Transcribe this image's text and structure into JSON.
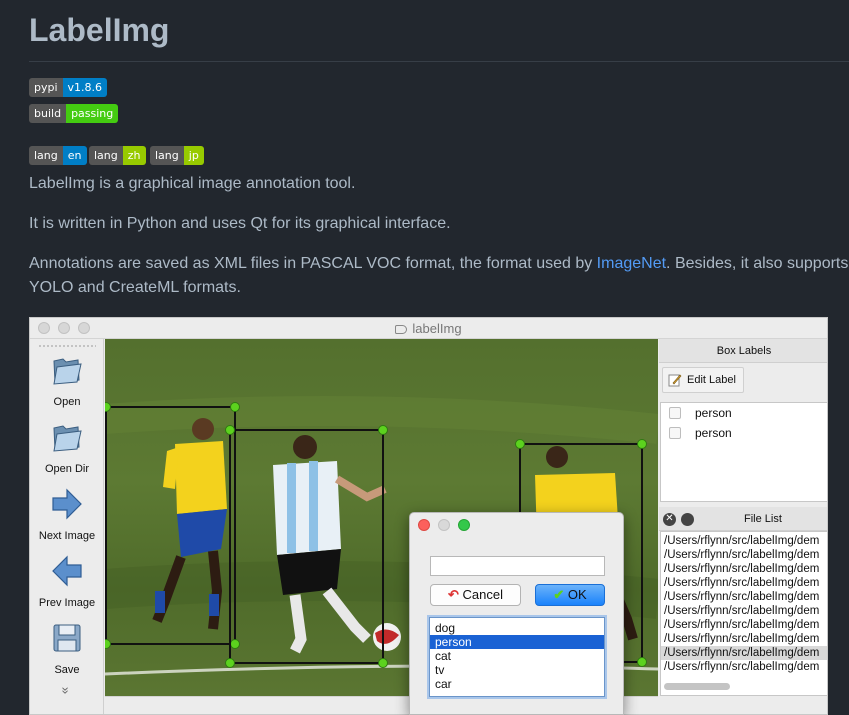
{
  "readme": {
    "title": "LabelImg",
    "badges": {
      "pypi": {
        "key": "pypi",
        "value": "v1.8.6",
        "color": "#007ec6"
      },
      "build": {
        "key": "build",
        "value": "passing",
        "color": "#4c1"
      },
      "lang_en": {
        "key": "lang",
        "value": "en",
        "color": "#007ec6"
      },
      "lang_zh": {
        "key": "lang",
        "value": "zh",
        "color": "#97ca00"
      },
      "lang_jp": {
        "key": "lang",
        "value": "jp",
        "color": "#97ca00"
      }
    },
    "paragraph1": "LabelImg is a graphical image annotation tool.",
    "paragraph2": "It is written in Python and uses Qt for its graphical interface.",
    "paragraph3_a": "Annotations are saved as XML files in PASCAL VOC format, the format used by ",
    "paragraph3_link": "ImageNet",
    "paragraph3_b": ". Besides, it also supports",
    "paragraph3_c": "YOLO and CreateML formats."
  },
  "app": {
    "window_title": "labelImg",
    "toolbar": [
      {
        "label": "Open",
        "icon": "folder-open-icon"
      },
      {
        "label": "Open Dir",
        "icon": "folder-open-icon"
      },
      {
        "label": "Next Image",
        "icon": "arrow-right-icon"
      },
      {
        "label": "Prev Image",
        "icon": "arrow-left-icon"
      },
      {
        "label": "Save",
        "icon": "save-icon"
      }
    ],
    "more_glyph": "»",
    "box_labels_title": "Box Labels",
    "edit_label_button": "Edit Label",
    "box_labels": [
      "person",
      "person"
    ],
    "file_list_title": "File List",
    "files": [
      "/Users/rflynn/src/labelImg/dem",
      "/Users/rflynn/src/labelImg/dem",
      "/Users/rflynn/src/labelImg/dem",
      "/Users/rflynn/src/labelImg/dem",
      "/Users/rflynn/src/labelImg/dem",
      "/Users/rflynn/src/labelImg/dem",
      "/Users/rflynn/src/labelImg/dem",
      "/Users/rflynn/src/labelImg/dem",
      "/Users/rflynn/src/labelImg/dem",
      "/Users/rflynn/src/labelImg/dem"
    ],
    "selected_file_index": 8,
    "dialog": {
      "input_value": "",
      "cancel_label": "Cancel",
      "ok_label": "OK",
      "options": [
        "dog",
        "person",
        "cat",
        "tv",
        "car"
      ],
      "selected_option": "person"
    }
  }
}
